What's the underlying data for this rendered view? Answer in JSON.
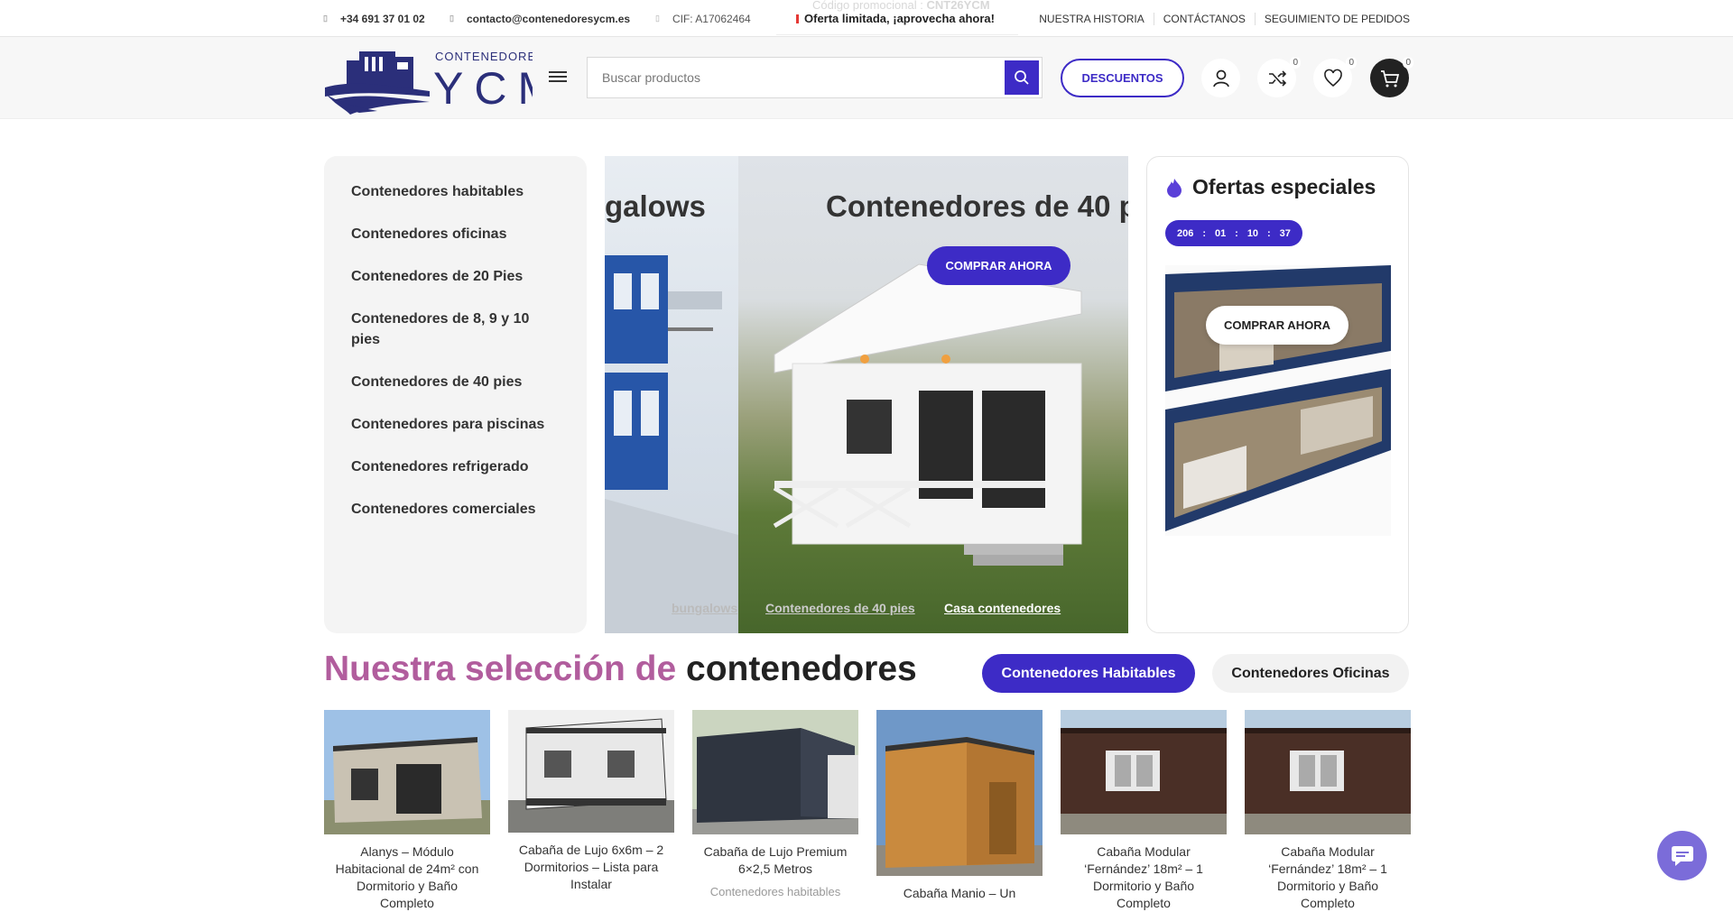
{
  "topbar": {
    "phone": "+34 691 37 01 02",
    "email": "contacto@contenedoresycm.es",
    "cif": "CIF: A17062464",
    "promo_label": "Código promocional :",
    "promo_code": "CNT26YCM",
    "offer": "Oferta limitada, ¡aprovecha ahora!",
    "links": [
      "NUESTRA HISTORIA",
      "CONTÁCTANOS",
      "SEGUIMIENTO DE PEDIDOS"
    ]
  },
  "header": {
    "logo_text_top": "CONTENEDORES",
    "logo_text_main": "YCM",
    "search_placeholder": "Buscar productos",
    "discount_label": "DESCUENTOS",
    "compare_count": "0",
    "wishlist_count": "0",
    "cart_count": "0"
  },
  "categories": [
    "Contenedores habitables",
    "Contenedores oficinas",
    "Contenedores de 20 Pies",
    "Contenedores de 8, 9 y 10 pies",
    "Contenedores de 40 pies",
    "Contenedores para piscinas",
    "Contenedores refrigerado",
    "Contenedores comerciales"
  ],
  "slider": {
    "title_prev": "galows",
    "title_current": "Contenedores de 40 p",
    "button": "COMPRAR AHORA",
    "tabs": [
      "bungalows",
      "Contenedores de 40 pies",
      "Casa contenedores"
    ]
  },
  "offers": {
    "title": "Ofertas especiales",
    "timer": [
      "206",
      "01",
      "10",
      "37"
    ],
    "button": "COMPRAR AHORA"
  },
  "selection": {
    "title_a": "Nuestra selección de",
    "title_b": "contenedores",
    "tabs": [
      "Contenedores Habitables",
      "Contenedores Oficinas"
    ]
  },
  "products": [
    {
      "name": "Alanys – Módulo Habitacional de 24m² con Dormitorio y Baño Completo",
      "category": ""
    },
    {
      "name": "Cabaña de Lujo 6x6m – 2 Dormitorios – Lista para Instalar",
      "category": ""
    },
    {
      "name": "Cabaña de Lujo Premium 6×2,5 Metros",
      "category": "Contenedores habitables"
    },
    {
      "name": "Cabaña Manio – Un",
      "category": ""
    },
    {
      "name": "Cabaña Modular ‘Fernández’ 18m² – 1 Dormitorio y Baño Completo",
      "category": ""
    },
    {
      "name": "Cabaña Modular ‘Fernández’ 18m² – 1 Dormitorio y Baño Completo",
      "category": ""
    }
  ],
  "colors": {
    "accent": "#3d2bc6",
    "title_pink": "#b15d9d",
    "chat": "#7b6cd9"
  }
}
